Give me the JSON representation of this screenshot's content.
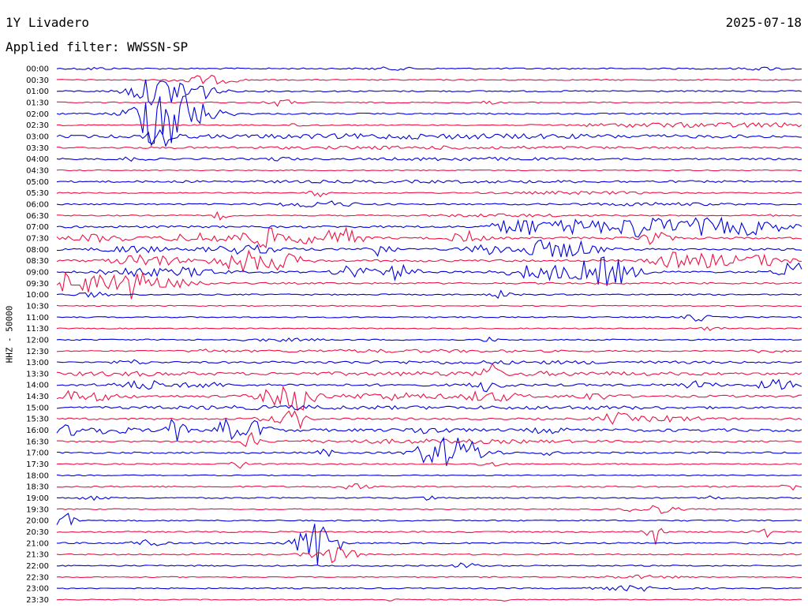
{
  "header": {
    "title": "1Y Livadero",
    "date": "2025-07-18",
    "filter": "Applied filter: WWSSN-SP",
    "ylabel": "HHZ - 50000"
  },
  "colors": {
    "even_row": "#0000dd",
    "odd_row": "#ee1144"
  },
  "chart_data": {
    "type": "line",
    "title": "1Y Livadero",
    "subtitle": "Applied filter: WWSSN-SP",
    "ylabel": "HHZ - 50000",
    "xlabel": "",
    "date": "2025-07-18",
    "row_labels": [
      "00:00",
      "00:30",
      "01:00",
      "01:30",
      "02:00",
      "02:30",
      "03:00",
      "03:30",
      "04:00",
      "04:30",
      "05:00",
      "05:30",
      "06:00",
      "06:30",
      "07:00",
      "07:30",
      "08:00",
      "08:30",
      "09:00",
      "09:30",
      "10:00",
      "10:30",
      "11:00",
      "11:30",
      "12:00",
      "12:30",
      "13:00",
      "13:30",
      "14:00",
      "14:30",
      "15:00",
      "15:30",
      "16:00",
      "16:30",
      "17:00",
      "17:30",
      "18:00",
      "18:30",
      "19:00",
      "19:30",
      "20:00",
      "20:30",
      "21:00",
      "21:30",
      "22:00",
      "22:30",
      "23:00",
      "23:30"
    ],
    "rows": [
      {
        "noise": 1.0,
        "events": [
          [
            0.05,
            1.5,
            0.02
          ],
          [
            0.45,
            1.5,
            0.03
          ],
          [
            0.95,
            1.5,
            0.03
          ]
        ]
      },
      {
        "noise": 0.8,
        "events": [
          [
            0.17,
            4,
            0.02
          ],
          [
            0.2,
            5,
            0.02
          ],
          [
            0.23,
            3,
            0.02
          ]
        ]
      },
      {
        "noise": 1.0,
        "events": [
          [
            0.12,
            8,
            0.03
          ],
          [
            0.14,
            10,
            0.03
          ],
          [
            0.18,
            15,
            0.03
          ]
        ]
      },
      {
        "noise": 0.8,
        "events": [
          [
            0.3,
            5,
            0.015
          ],
          [
            0.58,
            2,
            0.01
          ]
        ]
      },
      {
        "noise": 1.0,
        "events": [
          [
            0.14,
            35,
            0.03
          ],
          [
            0.16,
            20,
            0.05
          ]
        ]
      },
      {
        "noise": 0.8,
        "events": [
          [
            0.8,
            2.5,
            0.1
          ],
          [
            0.95,
            2.5,
            0.08
          ],
          [
            0.33,
            2,
            0.02
          ]
        ]
      },
      {
        "noise": 1.8,
        "events": [
          [
            0.14,
            20,
            0.015
          ],
          [
            0.5,
            2,
            0.3
          ]
        ]
      },
      {
        "noise": 0.9,
        "events": [
          [
            0.5,
            1.5,
            0.3
          ]
        ]
      },
      {
        "noise": 1.2,
        "events": [
          [
            0.1,
            2,
            0.02
          ],
          [
            0.3,
            2,
            0.02
          ],
          [
            0.55,
            1.5,
            0.1
          ]
        ]
      },
      {
        "noise": 0.7,
        "events": []
      },
      {
        "noise": 1.0,
        "events": [
          [
            0.5,
            1,
            0.4
          ]
        ]
      },
      {
        "noise": 0.8,
        "events": [
          [
            0.35,
            6,
            0.01
          ],
          [
            0.7,
            1.5,
            0.1
          ]
        ]
      },
      {
        "noise": 1.0,
        "events": [
          [
            0.35,
            4,
            0.05
          ],
          [
            0.8,
            1.5,
            0.1
          ]
        ]
      },
      {
        "noise": 0.8,
        "events": [
          [
            0.22,
            5,
            0.01
          ],
          [
            0.6,
            1.5,
            0.1
          ],
          [
            0.95,
            3,
            0.01
          ]
        ]
      },
      {
        "noise": 1.5,
        "events": [
          [
            0.62,
            12,
            0.03
          ],
          [
            0.7,
            10,
            0.04
          ],
          [
            0.78,
            12,
            0.03
          ],
          [
            0.85,
            9,
            0.06
          ],
          [
            0.93,
            8,
            0.05
          ]
        ]
      },
      {
        "noise": 1.5,
        "events": [
          [
            0.06,
            4,
            0.04
          ],
          [
            0.2,
            6,
            0.05
          ],
          [
            0.28,
            12,
            0.03
          ],
          [
            0.35,
            8,
            0.03
          ],
          [
            0.39,
            10,
            0.02
          ],
          [
            0.55,
            8,
            0.02
          ],
          [
            0.8,
            10,
            0.02
          ]
        ]
      },
      {
        "noise": 1.5,
        "events": [
          [
            0.1,
            4,
            0.04
          ],
          [
            0.25,
            5,
            0.05
          ],
          [
            0.43,
            8,
            0.02
          ],
          [
            0.58,
            6,
            0.03
          ],
          [
            0.65,
            10,
            0.03
          ],
          [
            0.7,
            9,
            0.03
          ]
        ]
      },
      {
        "noise": 1.6,
        "events": [
          [
            0.12,
            8,
            0.04
          ],
          [
            0.25,
            12,
            0.04
          ],
          [
            0.3,
            8,
            0.03
          ],
          [
            0.82,
            10,
            0.02
          ],
          [
            0.87,
            8,
            0.03
          ],
          [
            0.94,
            7,
            0.04
          ]
        ]
      },
      {
        "noise": 1.4,
        "events": [
          [
            0.1,
            5,
            0.04
          ],
          [
            0.18,
            5,
            0.04
          ],
          [
            0.4,
            12,
            0.02
          ],
          [
            0.46,
            10,
            0.02
          ],
          [
            0.65,
            10,
            0.04
          ],
          [
            0.72,
            12,
            0.03
          ],
          [
            0.75,
            12,
            0.03
          ],
          [
            0.99,
            12,
            0.02
          ]
        ]
      },
      {
        "noise": 1.2,
        "events": [
          [
            0.02,
            14,
            0.02
          ],
          [
            0.08,
            16,
            0.04
          ],
          [
            0.12,
            10,
            0.03
          ],
          [
            0.18,
            6,
            0.02
          ]
        ]
      },
      {
        "noise": 0.9,
        "events": [
          [
            0.6,
            5,
            0.015
          ],
          [
            0.05,
            3,
            0.02
          ]
        ]
      },
      {
        "noise": 0.7,
        "events": []
      },
      {
        "noise": 0.8,
        "events": [
          [
            0.86,
            5,
            0.015
          ]
        ]
      },
      {
        "noise": 0.7,
        "events": [
          [
            0.88,
            2,
            0.02
          ]
        ]
      },
      {
        "noise": 0.9,
        "events": [
          [
            0.58,
            3,
            0.01
          ],
          [
            0.3,
            1.5,
            0.05
          ]
        ]
      },
      {
        "noise": 0.8,
        "events": [
          [
            0.2,
            2,
            0.02
          ],
          [
            0.45,
            1.5,
            0.2
          ],
          [
            0.95,
            2,
            0.02
          ]
        ]
      },
      {
        "noise": 1.0,
        "events": [
          [
            0.1,
            3,
            0.02
          ],
          [
            0.6,
            1.5,
            0.3
          ]
        ]
      },
      {
        "noise": 1.2,
        "events": [
          [
            0.58,
            14,
            0.01
          ],
          [
            0.1,
            2,
            0.1
          ],
          [
            0.6,
            2,
            0.3
          ]
        ]
      },
      {
        "noise": 1.6,
        "events": [
          [
            0.12,
            5,
            0.04
          ],
          [
            0.2,
            4,
            0.02
          ],
          [
            0.58,
            8,
            0.02
          ],
          [
            0.86,
            5,
            0.02
          ],
          [
            0.97,
            6,
            0.03
          ]
        ]
      },
      {
        "noise": 1.6,
        "events": [
          [
            0.03,
            6,
            0.05
          ],
          [
            0.3,
            10,
            0.03
          ],
          [
            0.33,
            14,
            0.02
          ],
          [
            0.45,
            4,
            0.06
          ],
          [
            0.58,
            6,
            0.04
          ],
          [
            0.72,
            4,
            0.03
          ]
        ]
      },
      {
        "noise": 1.0,
        "events": [
          [
            0.3,
            2,
            0.2
          ],
          [
            0.7,
            1.5,
            0.2
          ]
        ]
      },
      {
        "noise": 1.3,
        "events": [
          [
            0.32,
            14,
            0.01
          ],
          [
            0.3,
            4,
            0.03
          ],
          [
            0.75,
            7,
            0.02
          ],
          [
            0.82,
            3,
            0.05
          ]
        ]
      },
      {
        "noise": 2.0,
        "events": [
          [
            0.03,
            6,
            0.06
          ],
          [
            0.16,
            18,
            0.01
          ],
          [
            0.23,
            14,
            0.015
          ],
          [
            0.27,
            12,
            0.015
          ],
          [
            0.5,
            4,
            0.03
          ],
          [
            0.66,
            4,
            0.02
          ]
        ]
      },
      {
        "noise": 1.1,
        "events": [
          [
            0.26,
            10,
            0.01
          ],
          [
            0.5,
            2,
            0.2
          ]
        ]
      },
      {
        "noise": 1.2,
        "events": [
          [
            0.36,
            5,
            0.01
          ],
          [
            0.51,
            16,
            0.03
          ],
          [
            0.55,
            14,
            0.03
          ],
          [
            0.66,
            6,
            0.01
          ]
        ]
      },
      {
        "noise": 0.9,
        "events": [
          [
            0.25,
            6,
            0.015
          ],
          [
            0.58,
            3,
            0.015
          ]
        ]
      },
      {
        "noise": 0.7,
        "events": []
      },
      {
        "noise": 1.0,
        "events": [
          [
            0.4,
            3,
            0.02
          ],
          [
            0.985,
            6,
            0.01
          ]
        ]
      },
      {
        "noise": 0.9,
        "events": [
          [
            0.05,
            2,
            0.02
          ],
          [
            0.5,
            4,
            0.01
          ],
          [
            0.88,
            3,
            0.01
          ]
        ]
      },
      {
        "noise": 0.7,
        "events": [
          [
            0.8,
            6,
            0.03
          ]
        ]
      },
      {
        "noise": 0.9,
        "events": [
          [
            0.01,
            10,
            0.015
          ]
        ]
      },
      {
        "noise": 1.0,
        "events": [
          [
            0.8,
            18,
            0.01
          ],
          [
            0.95,
            8,
            0.01
          ]
        ]
      },
      {
        "noise": 1.1,
        "events": [
          [
            0.12,
            4,
            0.02
          ],
          [
            0.35,
            32,
            0.025
          ]
        ]
      },
      {
        "noise": 0.9,
        "events": [
          [
            0.37,
            10,
            0.03
          ]
        ]
      },
      {
        "noise": 0.9,
        "events": [
          [
            0.55,
            4,
            0.015
          ]
        ]
      },
      {
        "noise": 0.7,
        "events": [
          [
            0.78,
            2,
            0.05
          ]
        ]
      },
      {
        "noise": 0.8,
        "events": [
          [
            0.78,
            3,
            0.05
          ]
        ]
      },
      {
        "noise": 0.7,
        "events": [
          [
            0.45,
            3,
            0.005
          ],
          [
            0.6,
            3,
            0.005
          ]
        ]
      }
    ],
    "grid": false,
    "legend": "none"
  }
}
